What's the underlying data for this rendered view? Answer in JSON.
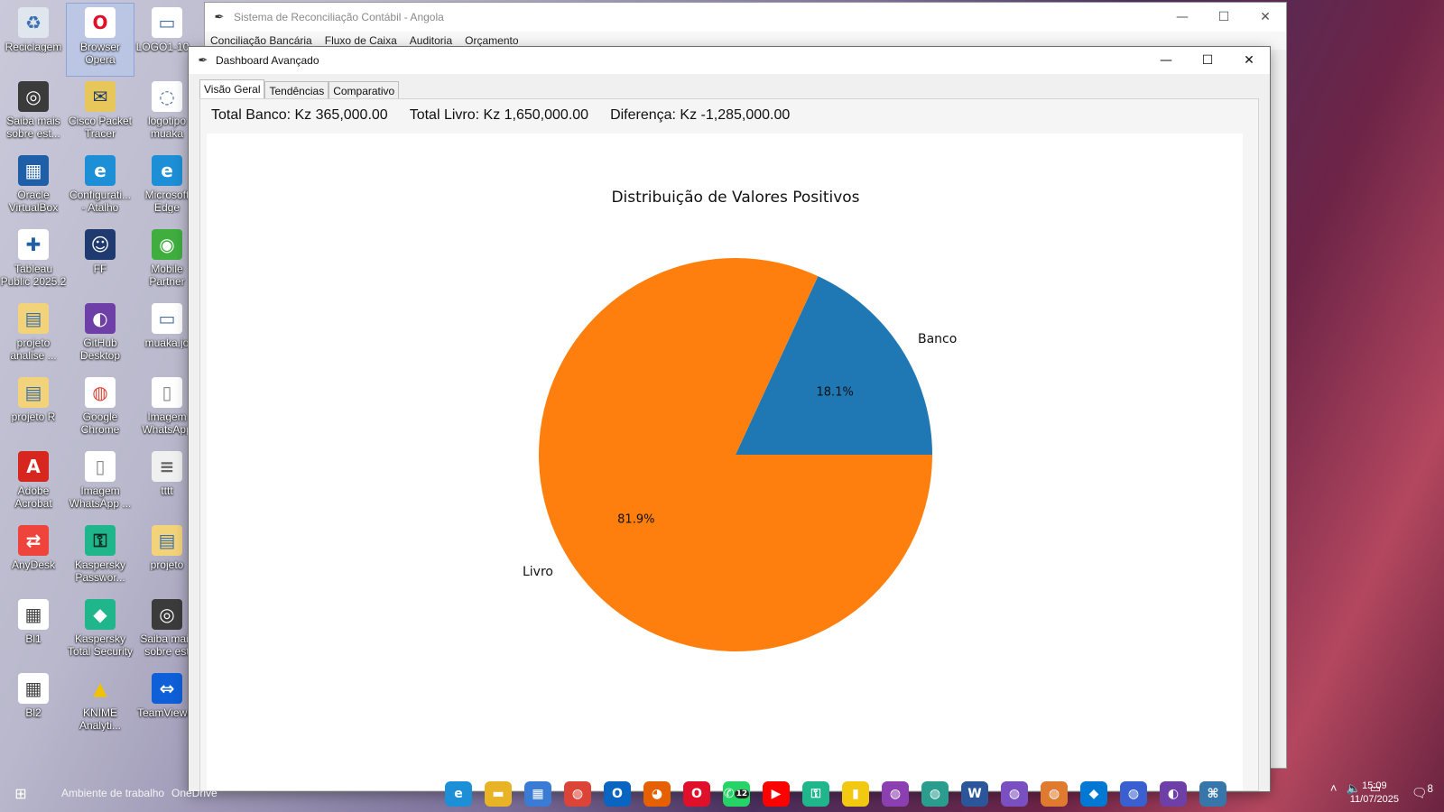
{
  "desktop": {
    "icons": [
      {
        "label": "Reciclagem",
        "icon": "recycle-bin-icon",
        "glyph": "♻",
        "color": "#dfe6ee",
        "fg": "#3a6fb0"
      },
      {
        "label": "Browser Opera",
        "icon": "opera-icon",
        "glyph": "O",
        "color": "#ffffff",
        "fg": "#e0102a"
      },
      {
        "label": "LOGO1-10...",
        "icon": "image-file-icon",
        "glyph": "▭",
        "color": "#ffffff",
        "fg": "#4a6fa5"
      },
      {
        "label": "Saiba mais sobre est...",
        "icon": "info-circle-icon",
        "glyph": "◎",
        "color": "#3b3b3b",
        "fg": "#ffffff"
      },
      {
        "label": "Cisco Packet Tracer",
        "icon": "cisco-icon",
        "glyph": "✉",
        "color": "#e8c75a",
        "fg": "#1e3a6e"
      },
      {
        "label": "logotipo muaka",
        "icon": "image-file-icon",
        "glyph": "◌",
        "color": "#ffffff",
        "fg": "#4a6fa5"
      },
      {
        "label": "Oracle VirtualBox",
        "icon": "virtualbox-icon",
        "glyph": "▦",
        "color": "#1f5fa8",
        "fg": "#ffffff"
      },
      {
        "label": "Configurati... - Atalho",
        "icon": "edge-icon",
        "glyph": "e",
        "color": "#1c8fd6",
        "fg": "#ffffff"
      },
      {
        "label": "Microsoft Edge",
        "icon": "edge-icon",
        "glyph": "e",
        "color": "#1c8fd6",
        "fg": "#ffffff"
      },
      {
        "label": "Tableau Public 2025.2",
        "icon": "tableau-icon",
        "glyph": "✚",
        "color": "#ffffff",
        "fg": "#1f5fa8"
      },
      {
        "label": "FF",
        "icon": "photo-file-icon",
        "glyph": "☺",
        "color": "#1f3a6e",
        "fg": "#ffffff"
      },
      {
        "label": "Mobile Partner",
        "icon": "mobile-partner-icon",
        "glyph": "◉",
        "color": "#3fae3f",
        "fg": "#ffffff"
      },
      {
        "label": "projeto analise ...",
        "icon": "folder-icon",
        "glyph": "▤",
        "color": "#f3d37a",
        "fg": "#3a6fb0"
      },
      {
        "label": "GitHub Desktop",
        "icon": "github-icon",
        "glyph": "◐",
        "color": "#6f3fa8",
        "fg": "#ffffff"
      },
      {
        "label": "muaka.jo",
        "icon": "image-file-icon",
        "glyph": "▭",
        "color": "#ffffff",
        "fg": "#4a6fa5"
      },
      {
        "label": "projeto R",
        "icon": "folder-icon",
        "glyph": "▤",
        "color": "#f3d37a",
        "fg": "#3a6fb0"
      },
      {
        "label": "Google Chrome",
        "icon": "chrome-icon",
        "glyph": "◍",
        "color": "#ffffff",
        "fg": "#db4437"
      },
      {
        "label": "Imagem WhatsApp",
        "icon": "file-icon",
        "glyph": "▯",
        "color": "#ffffff",
        "fg": "#888888"
      },
      {
        "label": "Adobe Acrobat",
        "icon": "acrobat-icon",
        "glyph": "A",
        "color": "#d7261e",
        "fg": "#ffffff"
      },
      {
        "label": "Imagem WhatsApp ...",
        "icon": "file-icon",
        "glyph": "▯",
        "color": "#ffffff",
        "fg": "#888888"
      },
      {
        "label": "tttt",
        "icon": "document-icon",
        "glyph": "≡",
        "color": "#f0f0f0",
        "fg": "#666666"
      },
      {
        "label": "AnyDesk",
        "icon": "anydesk-icon",
        "glyph": "⇄",
        "color": "#ef443b",
        "fg": "#ffffff"
      },
      {
        "label": "Kaspersky Passwor...",
        "icon": "kaspersky-icon",
        "glyph": "⚿",
        "color": "#1fb68c",
        "fg": "#0c2b22"
      },
      {
        "label": "projeto",
        "icon": "folder-icon",
        "glyph": "▤",
        "color": "#f3d37a",
        "fg": "#3a6fb0"
      },
      {
        "label": "Bl1",
        "icon": "spreadsheet-file-icon",
        "glyph": "▦",
        "color": "#ffffff",
        "fg": "#444444"
      },
      {
        "label": "Kaspersky Total Security",
        "icon": "kaspersky-icon",
        "glyph": "◆",
        "color": "#1fb68c",
        "fg": "#ffffff"
      },
      {
        "label": "Saiba mais sobre est",
        "icon": "info-circle-icon",
        "glyph": "◎",
        "color": "#3b3b3b",
        "fg": "#ffffff"
      },
      {
        "label": "Bl2",
        "icon": "spreadsheet-file-icon",
        "glyph": "▦",
        "color": "#ffffff",
        "fg": "#444444"
      },
      {
        "label": "KNIME Analyti...",
        "icon": "knime-icon",
        "glyph": "▲",
        "color": "transparent",
        "fg": "#f2c200"
      },
      {
        "label": "TeamViewer",
        "icon": "teamviewer-icon",
        "glyph": "⇔",
        "color": "#0e5fd8",
        "fg": "#ffffff"
      }
    ]
  },
  "main_window": {
    "title": "Sistema de Reconciliação Contábil - Angola",
    "menu": [
      "Conciliação Bancária",
      "Fluxo de Caixa",
      "Auditoria",
      "Orçamento"
    ],
    "controls": {
      "minimize": "—",
      "maximize": "☐",
      "close": "✕"
    }
  },
  "dashboard": {
    "title": "Dashboard Avançado",
    "controls": {
      "minimize": "—",
      "maximize": "☐",
      "close": "✕"
    },
    "tabs": [
      {
        "label": "Visão Geral",
        "active": true
      },
      {
        "label": "Tendências",
        "active": false
      },
      {
        "label": "Comparativo",
        "active": false
      }
    ],
    "totals": {
      "banco": "Total Banco: Kz 365,000.00",
      "livro": "Total Livro: Kz 1,650,000.00",
      "diferenca": "Diferença: Kz -1,285,000.00"
    }
  },
  "chart_data": {
    "type": "pie",
    "title": "Distribuição de Valores Positivos",
    "categories": [
      "Banco",
      "Livro"
    ],
    "values": [
      365000,
      1650000
    ],
    "percent_labels": [
      "18.1%",
      "81.9%"
    ],
    "colors": [
      "#1f77b4",
      "#ff7f0e"
    ],
    "start_angle": 0,
    "direction": "counterclockwise"
  },
  "taskbar": {
    "workspace_label": "Ambiente de trabalho",
    "onedrive_label": "OneDrive",
    "apps": [
      {
        "name": "edge",
        "glyph": "e",
        "color": "#1c8fd6"
      },
      {
        "name": "file-explorer",
        "glyph": "▬",
        "color": "#e8b325"
      },
      {
        "name": "microsoft-store",
        "glyph": "▦",
        "color": "#3a7bd5"
      },
      {
        "name": "chrome",
        "glyph": "◍",
        "color": "#db4437"
      },
      {
        "name": "outlook",
        "glyph": "O",
        "color": "#0a64c2"
      },
      {
        "name": "firefox",
        "glyph": "◕",
        "color": "#e66000"
      },
      {
        "name": "opera",
        "glyph": "O",
        "color": "#e0102a"
      },
      {
        "name": "whatsapp",
        "glyph": "✆",
        "color": "#25d366",
        "badge": "12"
      },
      {
        "name": "youtube",
        "glyph": "▶",
        "color": "#ff0000"
      },
      {
        "name": "kaspersky",
        "glyph": "⚿",
        "color": "#1fb68c"
      },
      {
        "name": "power-bi",
        "glyph": "▮",
        "color": "#f2c811"
      },
      {
        "name": "chrome-profile-m",
        "glyph": "◍",
        "color": "#8b3fb0"
      },
      {
        "name": "chrome-profile-s",
        "glyph": "◍",
        "color": "#2a9d8f"
      },
      {
        "name": "word",
        "glyph": "W",
        "color": "#2b579a"
      },
      {
        "name": "chrome-profile-m2",
        "glyph": "◍",
        "color": "#7a4fc0"
      },
      {
        "name": "chrome-profile-p",
        "glyph": "◍",
        "color": "#e07a2e"
      },
      {
        "name": "vscode",
        "glyph": "◆",
        "color": "#0078d4"
      },
      {
        "name": "chrome-profile-a",
        "glyph": "◍",
        "color": "#3a5fd0"
      },
      {
        "name": "github-desktop",
        "glyph": "◐",
        "color": "#6f3fa8"
      },
      {
        "name": "python",
        "glyph": "⌘",
        "color": "#3776ab"
      }
    ],
    "clock_time": "15:09",
    "clock_date": "11/07/2025",
    "notification_count": "8"
  }
}
